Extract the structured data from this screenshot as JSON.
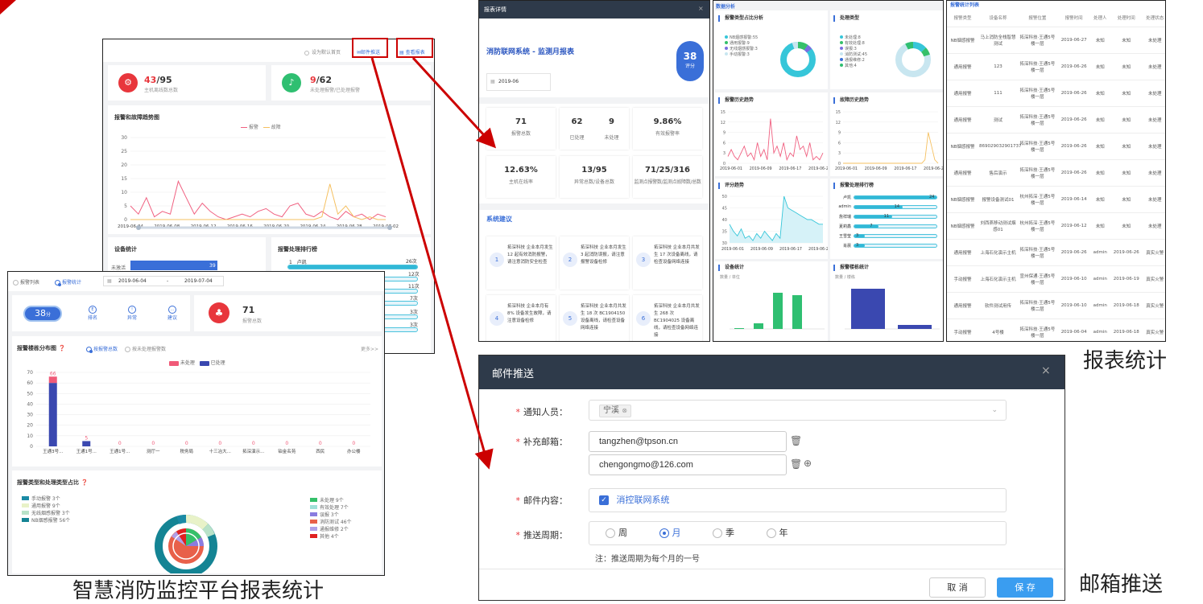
{
  "captions": {
    "main": "智慧消防监控平台报表统计",
    "report": "报表统计",
    "mail": "邮箱推送"
  },
  "dash1": {
    "default_label": "设为默认首页",
    "mail_push": "邮件推送",
    "view_report": "查看报表",
    "host_count": "43",
    "host_total": "/95",
    "host_sub": "主机离线数总数",
    "alarm_count": "9",
    "alarm_total": "/62",
    "alarm_sub": "未处理报警/已处理报警",
    "trend_title": "报警和故障趋势图",
    "legend_alarm": "报警",
    "legend_fault": "故障",
    "yticks": [
      "30",
      "25",
      "20",
      "15",
      "10",
      "5",
      "0"
    ],
    "xticks": [
      "2019-06-04",
      "2019-06-08",
      "2019-06-12",
      "2019-06-16",
      "2019-06-20",
      "2019-06-24",
      "2019-06-28",
      "2019-07-02"
    ],
    "device_title": "设备统计",
    "device_row": "未激活",
    "device_val": "39",
    "rank_title": "报警处理排行榜",
    "rank_first": "1",
    "rank_first_name": "卢凯",
    "rank_vals": [
      "26次",
      "12次",
      "11次",
      "7次",
      "3次",
      "3次"
    ]
  },
  "dash2": {
    "tab_list": "报警列表",
    "tab_stats": "报警统计",
    "date_from": "2019-06-04",
    "date_sep": "-",
    "date_to": "2019-07-04",
    "score": "38",
    "score_unit": "分",
    "icon1": "排名",
    "icon2": "异常",
    "icon3": "建议",
    "alarm_total": "71",
    "alarm_total_label": "报警总数",
    "dist_title": "报警楼栋分布图",
    "dist_opt1": "按报警总数",
    "dist_opt2": "按未处理报警数",
    "more": "更多>>",
    "leg_unhandled": "未处理",
    "leg_handled": "已处理",
    "yticks": [
      "70",
      "60",
      "50",
      "40",
      "30",
      "20",
      "10",
      "0"
    ],
    "pie_title": "报警类型和处理类型占比",
    "pie_left": [
      "手动报警 3个",
      "通用报警 9个",
      "无线烟感报警 3个",
      "NB烟感报警 56个"
    ],
    "pie_right": [
      "未处理 9个",
      "有效处理 7个",
      "误报 3个",
      "消防测试 46个",
      "通报维修 2个",
      "其他 4个"
    ]
  },
  "chart_data": {
    "type": "bar",
    "title": "报警楼栋分布图",
    "categories": [
      "王通3号...",
      "王通1号...",
      "王通1号...",
      "测厅一",
      "税务局",
      "十三冶大...",
      "拓深演示...",
      "铂金名苑",
      "西民",
      "办公楼"
    ],
    "series": [
      {
        "name": "未处理",
        "values": [
          6,
          0,
          0,
          0,
          0,
          0,
          0,
          0,
          0,
          0
        ]
      },
      {
        "name": "已处理",
        "values": [
          60,
          5,
          0,
          0,
          0,
          0,
          0,
          0,
          0,
          0
        ]
      }
    ],
    "data_labels": [
      "66",
      "5",
      "0",
      "0",
      "0",
      "0",
      "0",
      "0",
      "0",
      "0"
    ],
    "ylim": [
      0,
      70
    ]
  },
  "report": {
    "title": "报表详情",
    "close": "×",
    "name": "消防联网系统 - 监测月报表",
    "score": "38",
    "score_unit": "评分",
    "month": "2019-06",
    "stats": [
      {
        "v": "71",
        "l": "报警总数"
      },
      {
        "v": "62",
        "l": "已处理"
      },
      {
        "v": "9",
        "l": "未处理"
      },
      {
        "v": "9.86%",
        "l": "有效报警率"
      },
      {
        "v": "12.63%",
        "l": "主机在线率"
      },
      {
        "v": "13/95",
        "l": "异常总数/设备总数"
      },
      {
        "v": "71/25/316",
        "l": "监测点报警数/监测点故障数/总数"
      }
    ],
    "advice_title": "系统建议",
    "advice": [
      {
        "n": "1",
        "t": "拓深科技 企业本月发生 12 起有效消防报警，请注意消防安全检查"
      },
      {
        "n": "2",
        "t": "拓深科技 企业本月发生 3 起消防误报，请注意报警设备检修"
      },
      {
        "n": "3",
        "t": "拓深科技 企业本月共发生 17 次设备离线，请检查设备网络连接"
      },
      {
        "n": "4",
        "t": "拓深科技 企业本月有 8% 设备发生故障，请注意设备检修"
      },
      {
        "n": "5",
        "t": "拓深科技 企业本月共发生 18 次 BC1904150 设备离线，请检查设备网络连接"
      },
      {
        "n": "6",
        "t": "拓深科技 企业本月共发生 268 次 BC1904025 设备离线，请检查设备网络连接"
      }
    ]
  },
  "analysis": {
    "title": "数据分析",
    "p1": "报警类型占比分析",
    "p1_leg": [
      "NB烟感报警:55",
      "通用报警:9",
      "无线烟感报警:3",
      "手动报警:3"
    ],
    "p2": "处理类型",
    "p2_leg": [
      "未处理:8",
      "有效处理:8",
      "误报:3",
      "消防测试:45",
      "通报维修:2",
      "其他:4"
    ],
    "p3": "报警历史趋势",
    "p4": "故障历史趋势",
    "yt": [
      "15",
      "12",
      "9",
      "6",
      "3",
      "0"
    ],
    "xt": [
      "2019-06-01",
      "2019-06-09",
      "2019-06-17",
      "2019-06-25"
    ],
    "p5": "评分趋势",
    "yt5": [
      "50",
      "45",
      "40",
      "35",
      "30"
    ],
    "p6": "报警处理排行榜",
    "rank": [
      {
        "n": "卢凯",
        "v": "24"
      },
      {
        "n": "admin",
        "v": "14"
      },
      {
        "n": "詹祥瑞",
        "v": "11"
      },
      {
        "n": "夏莉鑫",
        "v": "7"
      },
      {
        "n": "王雪莹",
        "v": "3"
      },
      {
        "n": "肖晨",
        "v": "3"
      }
    ],
    "p7": "设备统计",
    "p7_y": "数量 / 单位",
    "p8": "报警楼栋统计",
    "p8_y": "数量 / 楼栋"
  },
  "table": {
    "title": "报警统计列表",
    "headers": [
      "报警类型",
      "设备名称",
      "报警位置",
      "报警时间",
      "处理人",
      "处理时间",
      "处理状态"
    ],
    "rows": [
      [
        "NB烟感报警",
        "马上消防全栈智慧测试",
        "拓深科技·王通5号楼一层",
        "2019-06-27",
        "未知",
        "未知",
        "未处理"
      ],
      [
        "通用报警",
        "123",
        "拓深科技·王通5号楼一层",
        "2019-06-26",
        "未知",
        "未知",
        "未处理"
      ],
      [
        "通用报警",
        "111",
        "拓深科技·王通5号楼一层",
        "2019-06-26",
        "未知",
        "未知",
        "未处理"
      ],
      [
        "通用报警",
        "测试",
        "拓深科技·王通5号楼一层",
        "2019-06-26",
        "未知",
        "未知",
        "未处理"
      ],
      [
        "NB烟感报警",
        "869029032901737",
        "拓深科技·王通5号楼一层",
        "2019-06-26",
        "未知",
        "未知",
        "未处理"
      ],
      [
        "通用报警",
        "售后演示",
        "拓深科技·王通5号楼一层",
        "2019-06-26",
        "未知",
        "未知",
        "未处理"
      ],
      [
        "NB烟感报警",
        "报警设备测试01",
        "杭州拓深·王通5号楼一层",
        "2019-06-14",
        "未知",
        "未知",
        "未处理"
      ],
      [
        "NB烟感报警",
        "刘西燕移动测试烟感01",
        "杭州拓深·王通5号楼一层",
        "2019-06-12",
        "未知",
        "未知",
        "未处理"
      ],
      [
        "通用报警",
        "上海石化演示主机",
        "拓深科技·王通5号楼一层",
        "2019-06-26",
        "admin",
        "2019-06-26",
        "真实火警"
      ],
      [
        "手动报警",
        "上海石化演示主机",
        "宣州保通·王通5号楼一层",
        "2019-06-10",
        "admin",
        "2019-06-19",
        "真实火警"
      ],
      [
        "通用报警",
        "软件测试用传",
        "拓深科技·王通5号楼二层",
        "2019-06-10",
        "admin",
        "2019-06-18",
        "真实火警"
      ],
      [
        "手动报警",
        "4号楼",
        "拓深科技·王通5号楼一层",
        "2019-06-04",
        "admin",
        "2019-06-18",
        "真实火警"
      ]
    ]
  },
  "mail": {
    "title": "邮件推送",
    "close": "×",
    "notify_label": "通知人员：",
    "notify_tag": "宁溪",
    "extra_label": "补充邮箱：",
    "email1": "tangzhen@tpson.cn",
    "email2": "chengongmo@126.com",
    "content_label": "邮件内容：",
    "content_value": "消控联网系统",
    "cycle_label": "推送周期：",
    "cycles": [
      "周",
      "月",
      "季",
      "年"
    ],
    "note": "注：推送周期为每个月的一号",
    "cancel": "取 消",
    "save": "保 存"
  },
  "colors": {
    "accent": "#3a6fd8",
    "alarm_red": "#e8363c",
    "dark_header": "#2e3a4a",
    "arrow": "#c00000",
    "green": "#2fbf71",
    "cyan": "#36c6d9"
  }
}
